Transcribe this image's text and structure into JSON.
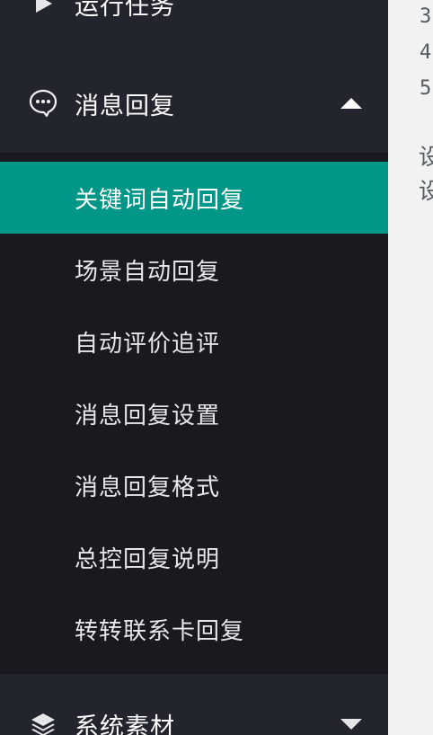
{
  "sidebar": {
    "menus": [
      {
        "label": "运行任务",
        "icon": "play-icon"
      },
      {
        "label": "消息回复",
        "icon": "chat-bubble-icon",
        "expanded": true
      },
      {
        "label": "系统素材",
        "icon": "layers-icon",
        "expanded": false
      }
    ],
    "submenu": [
      {
        "label": "关键词自动回复",
        "active": true
      },
      {
        "label": "场景自动回复"
      },
      {
        "label": "自动评价追评"
      },
      {
        "label": "消息回复设置"
      },
      {
        "label": "消息回复格式"
      },
      {
        "label": "总控回复说明"
      },
      {
        "label": "转转联系卡回复"
      }
    ]
  },
  "content": {
    "line_numbers": [
      "3",
      "4",
      "5"
    ],
    "text_fragments": [
      "设",
      "设"
    ]
  },
  "colors": {
    "sidebar_bg": "#22252e",
    "submenu_bg": "#191a20",
    "active_bg": "#009688",
    "text": "#ffffff",
    "content_bg": "#f2f2f2"
  }
}
